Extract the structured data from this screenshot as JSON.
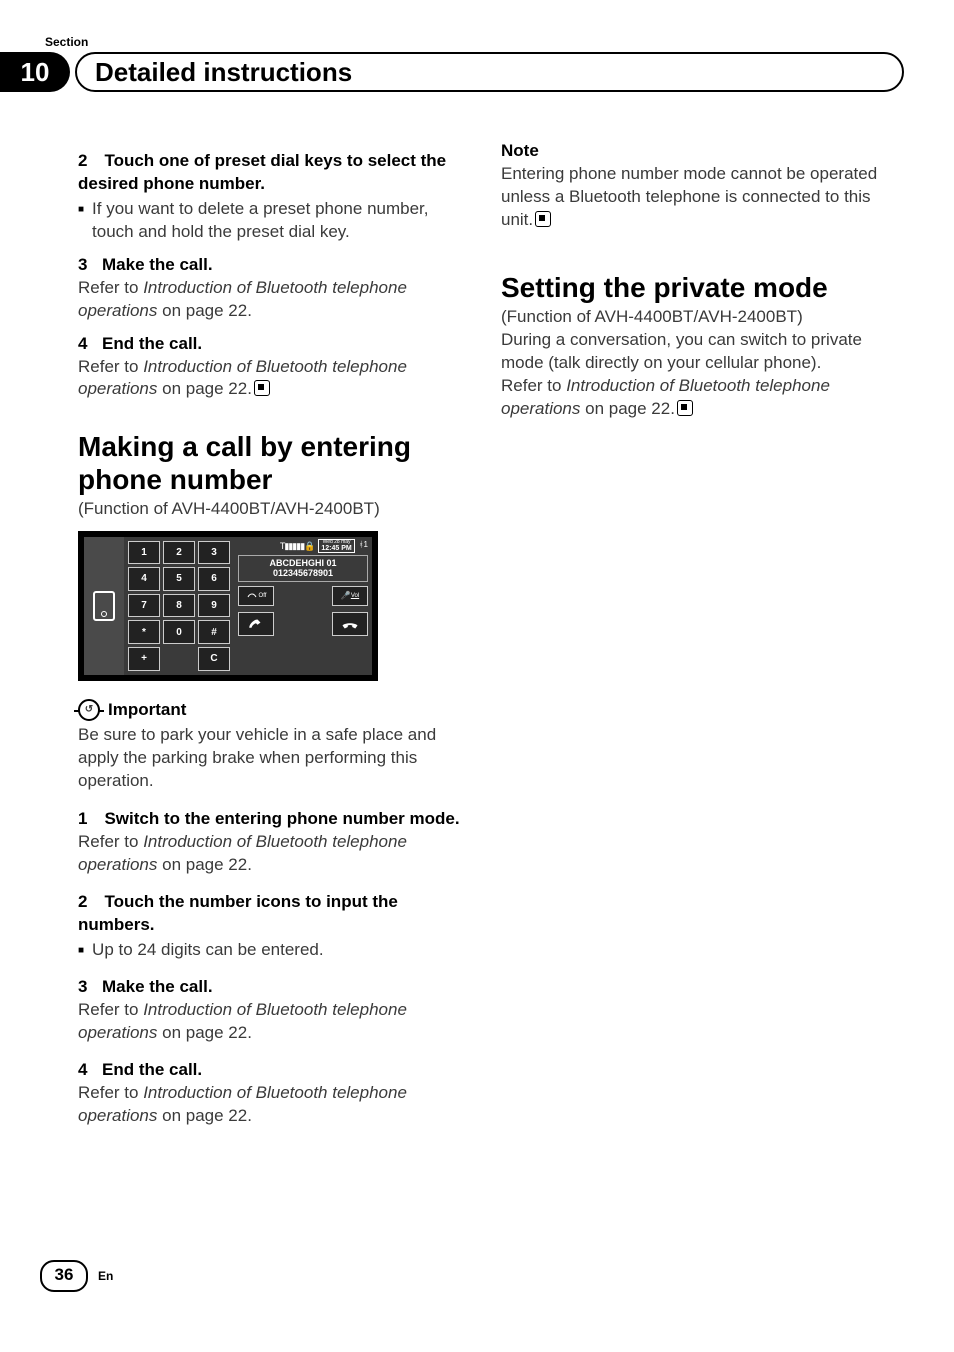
{
  "header": {
    "section_label": "Section",
    "section_number": "10",
    "chapter_title": "Detailed instructions"
  },
  "left": {
    "s2_head": "2 Touch one of preset dial keys to select the desired phone number.",
    "s2_bullet": "If you want to delete a preset phone number, touch and hold the preset dial key.",
    "s3_head_num": "3",
    "s3_head_text": "Make the call.",
    "s3_ref_a": "Refer to ",
    "s3_ref_i": "Introduction of Bluetooth telephone operations",
    "s3_ref_b": " on page 22.",
    "s4_head_num": "4",
    "s4_head_text": "End the call.",
    "s4_ref_a": "Refer to ",
    "s4_ref_i": "Introduction of Bluetooth telephone operations",
    "s4_ref_b": " on page 22.",
    "h2": "Making a call by entering phone number",
    "func": "(Function of AVH-4400BT/AVH-2400BT)",
    "important_label": "Important",
    "important_body": "Be sure to park your vehicle in a safe place and apply the parking brake when performing this operation.",
    "p1_head": "1 Switch to the entering phone number mode.",
    "p1_ref_a": "Refer to ",
    "p1_ref_i": "Introduction of Bluetooth telephone operations",
    "p1_ref_b": " on page 22.",
    "p2_head": "2 Touch the number icons to input the numbers.",
    "p2_bullet": "Up to 24 digits can be entered.",
    "p3_head_num": "3",
    "p3_head_text": "Make the call.",
    "p3_ref_a": "Refer to ",
    "p3_ref_i": "Introduction of Bluetooth telephone operations",
    "p3_ref_b": " on page 22.",
    "p4_head_num": "4",
    "p4_head_text": "End the call.",
    "p4_ref_a": "Refer to ",
    "p4_ref_i": "Introduction of Bluetooth telephone operations",
    "p4_ref_b": " on page 22."
  },
  "screenshot": {
    "keys": [
      "1",
      "2",
      "3",
      "4",
      "5",
      "6",
      "7",
      "8",
      "9",
      "*",
      "0",
      "#",
      "+",
      "",
      "C"
    ],
    "signal_label": "T",
    "date_line1": "Wed 28 may",
    "date_line2": "12:45 PM",
    "bt_label": "1",
    "name": "ABCDEHGHI  01",
    "number": "012345678901",
    "off_label": "Off",
    "vol_label": "Vol"
  },
  "right": {
    "note_label": "Note",
    "note_body": "Entering phone number mode cannot be operated unless a Bluetooth telephone is connected to this unit.",
    "h2": "Setting the private mode",
    "func": "(Function of AVH-4400BT/AVH-2400BT)",
    "body1": "During a conversation, you can switch to private mode (talk directly on your cellular phone).",
    "ref_a": "Refer to ",
    "ref_i": "Introduction of Bluetooth telephone operations",
    "ref_b": " on page 22."
  },
  "footer": {
    "page": "36",
    "lang": "En"
  }
}
